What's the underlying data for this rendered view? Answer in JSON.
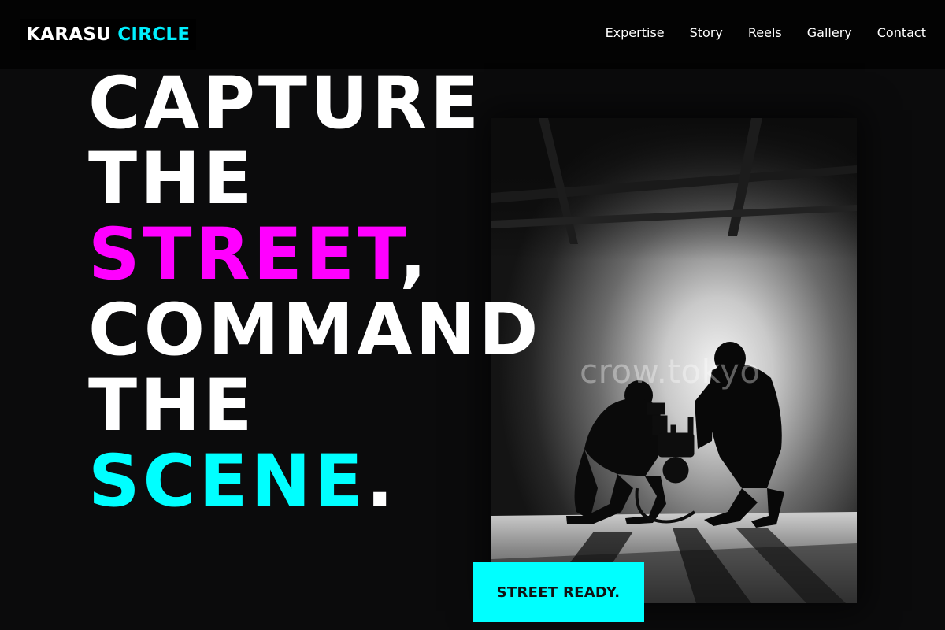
{
  "brand": {
    "part1": "KARASU",
    "part2": "CIRCLE",
    "accent_color": "#00f0ff"
  },
  "nav": {
    "items": [
      {
        "label": "Expertise"
      },
      {
        "label": "Story"
      },
      {
        "label": "Reels"
      },
      {
        "label": "Gallery"
      },
      {
        "label": "Contact"
      }
    ]
  },
  "hero": {
    "line1": "CAPTURE",
    "line2": "THE",
    "line3_highlight": "STREET",
    "line3_punct": ",",
    "line4": "COMMAND",
    "line5": "THE",
    "line6_highlight": "SCENE",
    "line6_punct": ".",
    "highlight_colors": {
      "street": "#ff00ff",
      "scene": "#00ffff"
    },
    "photo_watermark": "crow.tokyo",
    "cta_label": "STREET READY."
  },
  "icons": {
    "hero_photo": "film-crew-photo"
  }
}
